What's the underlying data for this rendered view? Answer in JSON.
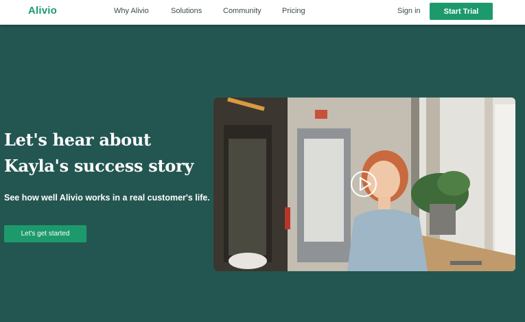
{
  "nav": {
    "logo": "Alivio",
    "links": [
      "Why Alivio",
      "Solutions",
      "Community",
      "Pricing"
    ],
    "signin": "Sign in",
    "trial": "Start Trial"
  },
  "hero": {
    "title": "Let's hear about Kayla's success story",
    "subtitle": "See how well Alivio works in a real customer's life.",
    "cta": "Let's get started"
  },
  "colors": {
    "accent": "#1d9a6c",
    "background": "#245651"
  },
  "icons": {
    "play": "play-icon",
    "exit_sign": "exit-sign-icon"
  }
}
